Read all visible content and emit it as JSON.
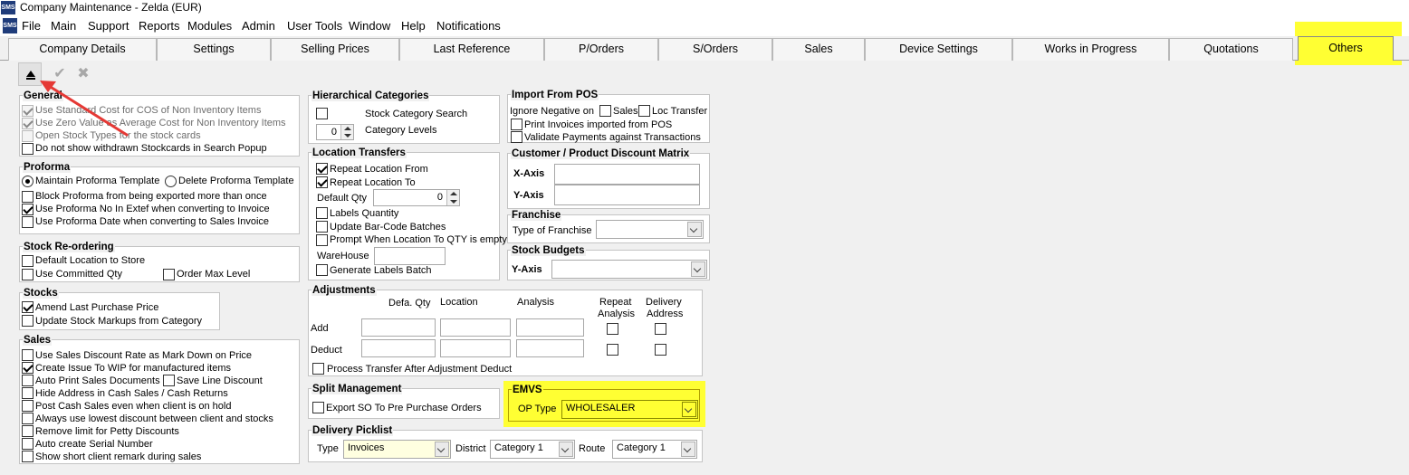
{
  "window": {
    "title": "Company Maintenance - Zelda (EUR)",
    "icon": "app-icon"
  },
  "menu": [
    "File",
    "Main",
    "Support",
    "Reports",
    "Modules",
    "Admin",
    "User Tools",
    "Window",
    "Help",
    "Notifications"
  ],
  "tabs": [
    "Company Details",
    "Settings",
    "Selling Prices",
    "Last Reference",
    "P/Orders",
    "S/Orders",
    "Sales",
    "Device Settings",
    "Works in Progress",
    "Quotations",
    "Others"
  ],
  "active_tab": "Others",
  "toolbar": {
    "icons": [
      "collapse-up-icon",
      "confirm-check-icon",
      "cancel-x-icon"
    ]
  },
  "general": {
    "title": "General",
    "items": [
      {
        "label": "Use Standard Cost for COS of Non Inventory Items",
        "checked": true,
        "disabled": true
      },
      {
        "label": "Use Zero Value as Average Cost for Non Inventory Items",
        "checked": true,
        "disabled": true
      },
      {
        "label": "Open Stock Types for the stock cards",
        "checked": false,
        "disabled": true
      },
      {
        "label": "Do not show withdrawn Stockcards in Search Popup",
        "checked": false,
        "disabled": false
      }
    ]
  },
  "proforma": {
    "title": "Proforma",
    "radio_maintain": "Maintain Proforma Template",
    "radio_delete": "Delete Proforma Template",
    "selected": "maintain",
    "items": [
      {
        "label": "Block Proforma from being exported more than once",
        "checked": false
      },
      {
        "label": "Use Proforma No In Extef when converting to Invoice",
        "checked": true
      },
      {
        "label": "Use Proforma Date when converting to Sales Invoice",
        "checked": false
      }
    ]
  },
  "stock_reordering": {
    "title": "Stock Re-ordering",
    "default_location": "Default Location to Store",
    "use_committed": "Use Committed Qty",
    "order_max": "Order Max Level"
  },
  "stocks": {
    "title": "Stocks",
    "items": [
      {
        "label": "Amend Last Purchase Price",
        "checked": true
      },
      {
        "label": "Update Stock Markups from Category",
        "checked": false
      }
    ]
  },
  "sales": {
    "title": "Sales",
    "discount_markdown": "Use Sales Discount Rate as Mark Down on Price",
    "create_issue": "Create Issue To WIP for manufactured items",
    "auto_print": "Auto Print Sales Documents",
    "save_line": "Save Line Discount",
    "hide_address": "Hide Address in Cash Sales / Cash Returns",
    "post_cash": "Post Cash Sales even when client is on hold",
    "lowest_discount": "Always use lowest discount between client and stocks",
    "remove_limit": "Remove limit for Petty Discounts",
    "auto_serial": "Auto create Serial Number",
    "short_remark": "Show short client remark during sales"
  },
  "hier": {
    "title": "Hierarchical Categories",
    "search": "Stock Category Search",
    "levels_label": "Category Levels",
    "levels_value": "0"
  },
  "loc_transfers": {
    "title": "Location Transfers",
    "repeat_from": "Repeat Location From",
    "repeat_to": "Repeat Location To",
    "default_qty_label": "Default Qty",
    "default_qty_value": "0",
    "labels_qty": "Labels Quantity",
    "update_barcode": "Update Bar-Code Batches",
    "prompt_empty": "Prompt When Location To QTY is empty",
    "warehouse_label": "WareHouse",
    "warehouse_value": "",
    "gen_labels": "Generate Labels Batch"
  },
  "adjustments": {
    "title": "Adjustments",
    "col_qty": "Defa. Qty",
    "col_location": "Location",
    "col_analysis": "Analysis",
    "col_repeat_1": "Repeat",
    "col_repeat_2": "Analysis",
    "col_delivery_1": "Delivery",
    "col_delivery_2": "Address",
    "row_add": "Add",
    "row_deduct": "Deduct",
    "process_transfer": "Process Transfer After Adjustment Deduct"
  },
  "split": {
    "title": "Split Management",
    "export_so": "Export SO To Pre Purchase Orders"
  },
  "delivery": {
    "title": "Delivery Picklist",
    "type_label": "Type",
    "type_value": "Invoices",
    "district_label": "District",
    "district_value": "Category 1",
    "route_label": "Route",
    "route_value": "Category 1"
  },
  "import_pos": {
    "title": "Import From POS",
    "ignore_neg": "Ignore Negative on",
    "sales": "Sales",
    "loc_transfer": "Loc Transfer",
    "print_invoices": "Print Invoices imported from POS",
    "validate_payments": "Validate Payments against Transactions"
  },
  "discount_matrix": {
    "title": "Customer / Product Discount Matrix",
    "x_axis": "X-Axis",
    "y_axis": "Y-Axis",
    "x_value": "",
    "y_value": ""
  },
  "franchise": {
    "title": "Franchise",
    "type_label": "Type of Franchise",
    "type_value": ""
  },
  "stock_budgets": {
    "title": "Stock Budgets",
    "y_axis": "Y-Axis",
    "y_value": ""
  },
  "emvs": {
    "title": "EMVS",
    "op_type_label": "OP Type",
    "op_type_value": "WHOLESALER"
  },
  "colors": {
    "highlight": "#ffff33",
    "annotation_arrow": "#e53935"
  }
}
